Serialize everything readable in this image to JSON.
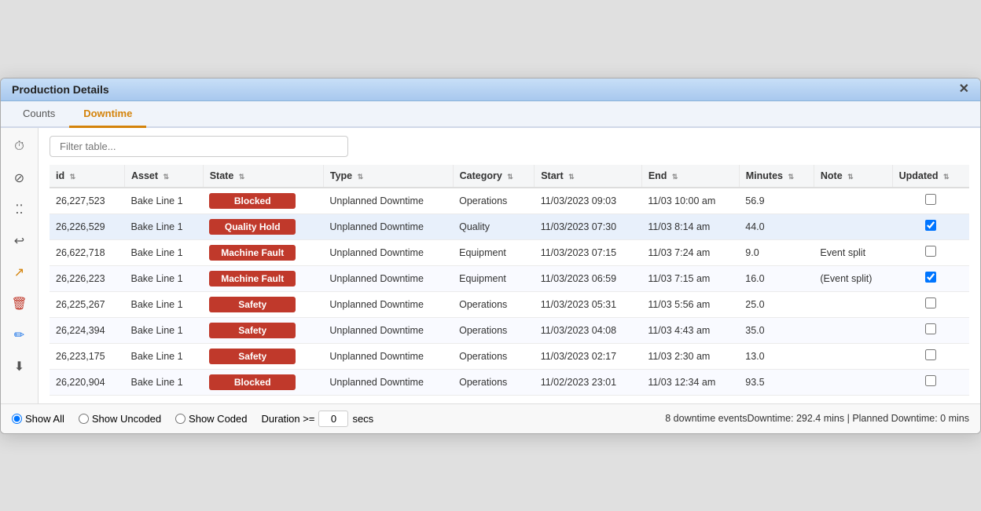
{
  "modal": {
    "title": "Production Details",
    "close_label": "✕"
  },
  "tabs": [
    {
      "id": "counts",
      "label": "Counts",
      "active": false
    },
    {
      "id": "downtime",
      "label": "Downtime",
      "active": true
    }
  ],
  "sidebar": {
    "icons": [
      {
        "id": "clock-icon",
        "symbol": "⏱",
        "active": false
      },
      {
        "id": "ban-icon",
        "symbol": "⊘",
        "active": false
      },
      {
        "id": "grid-icon",
        "symbol": "⁞⁞",
        "active": false
      },
      {
        "id": "undo-icon",
        "symbol": "↩",
        "active": false
      },
      {
        "id": "split-icon",
        "symbol": "↗",
        "active": false
      },
      {
        "id": "delete-icon",
        "symbol": "🗑",
        "active": false
      },
      {
        "id": "edit-icon",
        "symbol": "✏",
        "active": false
      },
      {
        "id": "download-icon",
        "symbol": "⬇",
        "active": false
      }
    ]
  },
  "filter": {
    "placeholder": "Filter table..."
  },
  "table": {
    "columns": [
      {
        "id": "id",
        "label": "id"
      },
      {
        "id": "asset",
        "label": "Asset"
      },
      {
        "id": "state",
        "label": "State"
      },
      {
        "id": "type",
        "label": "Type"
      },
      {
        "id": "category",
        "label": "Category"
      },
      {
        "id": "start",
        "label": "Start"
      },
      {
        "id": "end",
        "label": "End"
      },
      {
        "id": "minutes",
        "label": "Minutes"
      },
      {
        "id": "note",
        "label": "Note"
      },
      {
        "id": "updated",
        "label": "Updated"
      }
    ],
    "rows": [
      {
        "id": "26,227,523",
        "asset": "Bake Line 1",
        "state_label": "Blocked",
        "state_class": "state-blocked",
        "type": "Unplanned Downtime",
        "category": "Operations",
        "start": "11/03/2023 09:03",
        "end": "11/03 10:00 am",
        "minutes": "56.9",
        "note": "",
        "checked": false,
        "highlighted": false
      },
      {
        "id": "26,226,529",
        "asset": "Bake Line 1",
        "state_label": "Quality Hold",
        "state_class": "state-quality-hold",
        "type": "Unplanned Downtime",
        "category": "Quality",
        "start": "11/03/2023 07:30",
        "end": "11/03 8:14 am",
        "minutes": "44.0",
        "note": "",
        "checked": true,
        "highlighted": true
      },
      {
        "id": "26,622,718",
        "asset": "Bake Line 1",
        "state_label": "Machine Fault",
        "state_class": "state-machine-fault",
        "type": "Unplanned Downtime",
        "category": "Equipment",
        "start": "11/03/2023 07:15",
        "end": "11/03 7:24 am",
        "minutes": "9.0",
        "note": "Event split",
        "checked": false,
        "highlighted": false
      },
      {
        "id": "26,226,223",
        "asset": "Bake Line 1",
        "state_label": "Machine Fault",
        "state_class": "state-machine-fault",
        "type": "Unplanned Downtime",
        "category": "Equipment",
        "start": "11/03/2023 06:59",
        "end": "11/03 7:15 am",
        "minutes": "16.0",
        "note": "(Event split)",
        "checked": true,
        "highlighted": false
      },
      {
        "id": "26,225,267",
        "asset": "Bake Line 1",
        "state_label": "Safety",
        "state_class": "state-safety",
        "type": "Unplanned Downtime",
        "category": "Operations",
        "start": "11/03/2023 05:31",
        "end": "11/03 5:56 am",
        "minutes": "25.0",
        "note": "",
        "checked": false,
        "highlighted": false
      },
      {
        "id": "26,224,394",
        "asset": "Bake Line 1",
        "state_label": "Safety",
        "state_class": "state-safety",
        "type": "Unplanned Downtime",
        "category": "Operations",
        "start": "11/03/2023 04:08",
        "end": "11/03 4:43 am",
        "minutes": "35.0",
        "note": "",
        "checked": false,
        "highlighted": false
      },
      {
        "id": "26,223,175",
        "asset": "Bake Line 1",
        "state_label": "Safety",
        "state_class": "state-safety",
        "type": "Unplanned Downtime",
        "category": "Operations",
        "start": "11/03/2023 02:17",
        "end": "11/03 2:30 am",
        "minutes": "13.0",
        "note": "",
        "checked": false,
        "highlighted": false
      },
      {
        "id": "26,220,904",
        "asset": "Bake Line 1",
        "state_label": "Blocked",
        "state_class": "state-blocked",
        "type": "Unplanned Downtime",
        "category": "Operations",
        "start": "11/02/2023 23:01",
        "end": "11/03 12:34 am",
        "minutes": "93.5",
        "note": "",
        "checked": false,
        "highlighted": false
      }
    ]
  },
  "footer": {
    "show_all_label": "Show All",
    "show_uncoded_label": "Show Uncoded",
    "show_coded_label": "Show Coded",
    "duration_label": "Duration >=",
    "duration_value": "0",
    "duration_unit": "secs",
    "summary": "8 downtime eventsDowntime: 292.4 mins | Planned Downtime: 0 mins"
  }
}
